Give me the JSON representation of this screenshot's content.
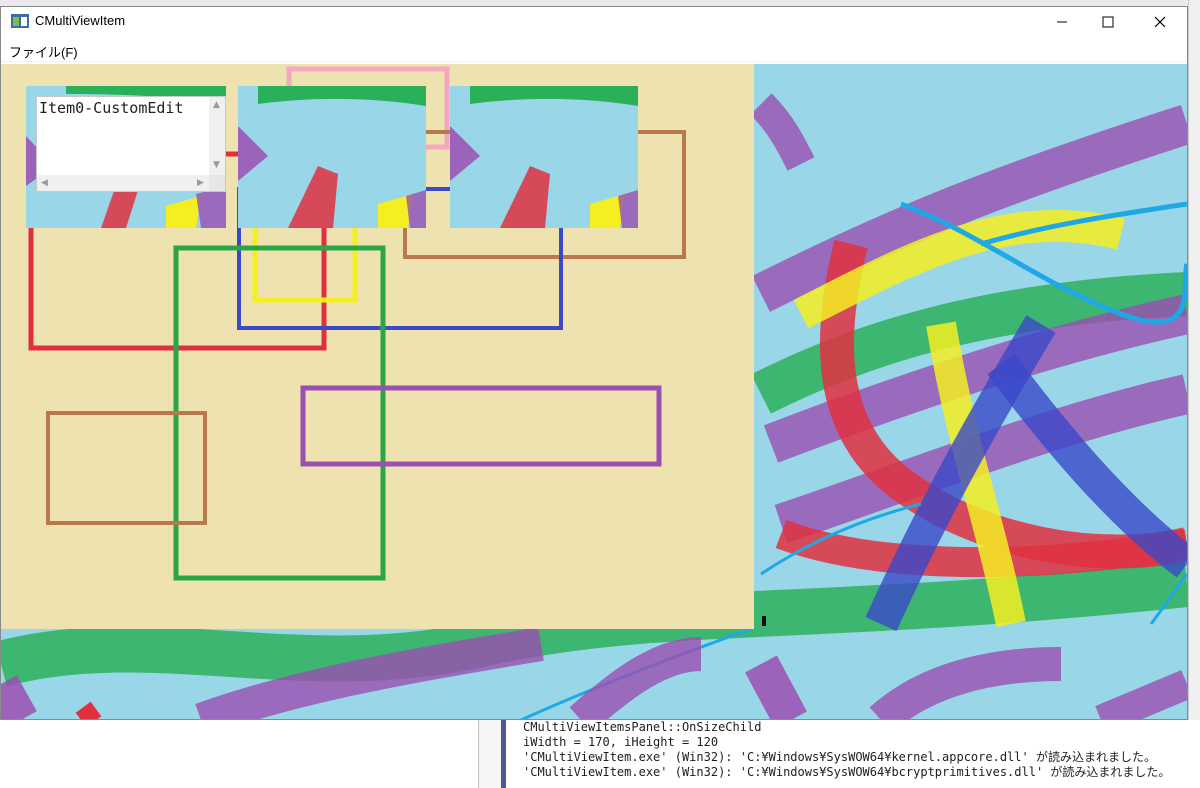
{
  "window": {
    "title": "CMultiViewItem",
    "menu": [
      "ファイル(F)"
    ]
  },
  "item_views": [
    {
      "edit_text": "Item0-CustomEdit"
    },
    {},
    {}
  ],
  "output": {
    "lines": [
      "CMultiViewItemsPanel::OnSizeChild",
      "iWidth = 170, iHeight = 120",
      "'CMultiViewItem.exe' (Win32): 'C:¥Windows¥SysWOW64¥kernel.appcore.dll' が読み込まれました。",
      "'CMultiViewItem.exe' (Win32): 'C:¥Windows¥SysWOW64¥bcryptprimitives.dll' が読み込まれました。"
    ]
  },
  "colors": {
    "panel_bg": "#efe2b1",
    "canvas_bg": "#98d6e8",
    "red": "#e03040",
    "blue": "#3b48c8",
    "green": "#2aa648",
    "yellow": "#f5ef22",
    "pink": "#f6a8c0",
    "brown": "#b8794c",
    "purple": "#9b4fb0",
    "cyan": "#1fa8e6"
  }
}
